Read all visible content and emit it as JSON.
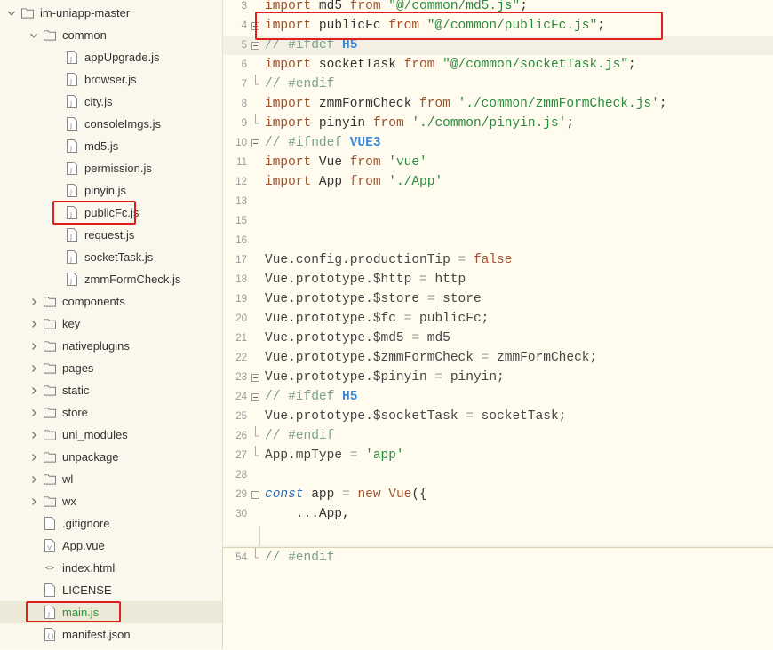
{
  "sidebar": {
    "items": [
      {
        "label": "im-uniapp-master",
        "type": "folder",
        "expanded": true,
        "indent": 0
      },
      {
        "label": "common",
        "type": "folder",
        "expanded": true,
        "indent": 1
      },
      {
        "label": "appUpgrade.js",
        "type": "js",
        "indent": 2
      },
      {
        "label": "browser.js",
        "type": "js",
        "indent": 2
      },
      {
        "label": "city.js",
        "type": "js",
        "indent": 2
      },
      {
        "label": "consoleImgs.js",
        "type": "js",
        "indent": 2
      },
      {
        "label": "md5.js",
        "type": "js",
        "indent": 2
      },
      {
        "label": "permission.js",
        "type": "js",
        "indent": 2
      },
      {
        "label": "pinyin.js",
        "type": "js",
        "indent": 2
      },
      {
        "label": "publicFc.js",
        "type": "js",
        "indent": 2
      },
      {
        "label": "request.js",
        "type": "js",
        "indent": 2
      },
      {
        "label": "socketTask.js",
        "type": "js",
        "indent": 2
      },
      {
        "label": "zmmFormCheck.js",
        "type": "js",
        "indent": 2
      },
      {
        "label": "components",
        "type": "folder",
        "expanded": false,
        "indent": 1
      },
      {
        "label": "key",
        "type": "folder",
        "expanded": false,
        "indent": 1
      },
      {
        "label": "nativeplugins",
        "type": "folder",
        "expanded": false,
        "indent": 1
      },
      {
        "label": "pages",
        "type": "folder",
        "expanded": false,
        "indent": 1
      },
      {
        "label": "static",
        "type": "folder",
        "expanded": false,
        "indent": 1
      },
      {
        "label": "store",
        "type": "folder",
        "expanded": false,
        "indent": 1
      },
      {
        "label": "uni_modules",
        "type": "folder",
        "expanded": false,
        "indent": 1
      },
      {
        "label": "unpackage",
        "type": "folder",
        "expanded": false,
        "indent": 1
      },
      {
        "label": "wl",
        "type": "folder",
        "expanded": false,
        "indent": 1
      },
      {
        "label": "wx",
        "type": "folder",
        "expanded": false,
        "indent": 1
      },
      {
        "label": ".gitignore",
        "type": "file",
        "indent": 1
      },
      {
        "label": "App.vue",
        "type": "vue",
        "indent": 1
      },
      {
        "label": "index.html",
        "type": "html",
        "indent": 1
      },
      {
        "label": "LICENSE",
        "type": "file",
        "indent": 1
      },
      {
        "label": "main.js",
        "type": "js",
        "indent": 1,
        "selected": true,
        "green": true
      },
      {
        "label": "manifest.json",
        "type": "json",
        "indent": 1
      }
    ]
  },
  "editor": {
    "lines": [
      {
        "n": "3",
        "fold": "",
        "tokens": [
          [
            "kw",
            "import"
          ],
          [
            "",
            " md5 "
          ],
          [
            "kw",
            "from"
          ],
          [
            "",
            " "
          ],
          [
            "str",
            "\"@/common/md5.js\""
          ],
          [
            "",
            ";"
          ]
        ]
      },
      {
        "n": "4",
        "fold": "box",
        "tokens": [
          [
            "kw",
            "import"
          ],
          [
            "",
            " publicFc "
          ],
          [
            "kw",
            "from"
          ],
          [
            "",
            " "
          ],
          [
            "str",
            "\"@/common/publicFc.js\""
          ],
          [
            "",
            ";"
          ]
        ]
      },
      {
        "n": "5",
        "fold": "box",
        "hl": true,
        "tokens": [
          [
            "cm",
            "// #ifdef "
          ],
          [
            "cmb",
            "H5"
          ]
        ]
      },
      {
        "n": "6",
        "fold": "",
        "tokens": [
          [
            "kw",
            "import"
          ],
          [
            "",
            " socketTask "
          ],
          [
            "kw",
            "from"
          ],
          [
            "",
            " "
          ],
          [
            "str",
            "\"@/common/socketTask.js\""
          ],
          [
            "",
            ";"
          ]
        ]
      },
      {
        "n": "7",
        "fold": "end",
        "tokens": [
          [
            "cm",
            "// #endif"
          ]
        ]
      },
      {
        "n": "8",
        "fold": "",
        "tokens": [
          [
            "kw",
            "import"
          ],
          [
            "",
            " zmmFormCheck "
          ],
          [
            "kw",
            "from"
          ],
          [
            "",
            " "
          ],
          [
            "str",
            "'./common/zmmFormCheck.js'"
          ],
          [
            "",
            ";"
          ]
        ]
      },
      {
        "n": "9",
        "fold": "end",
        "tokens": [
          [
            "kw",
            "import"
          ],
          [
            "",
            " pinyin "
          ],
          [
            "kw",
            "from"
          ],
          [
            "",
            " "
          ],
          [
            "str",
            "'./common/pinyin.js'"
          ],
          [
            "",
            ";"
          ]
        ]
      },
      {
        "n": "10",
        "fold": "box",
        "tokens": [
          [
            "cm",
            "// #ifndef "
          ],
          [
            "cmb",
            "VUE3"
          ]
        ]
      },
      {
        "n": "11",
        "fold": "",
        "tokens": [
          [
            "kw",
            "import"
          ],
          [
            "",
            " Vue "
          ],
          [
            "kw",
            "from"
          ],
          [
            "",
            " "
          ],
          [
            "str",
            "'vue'"
          ]
        ]
      },
      {
        "n": "12",
        "fold": "",
        "tokens": [
          [
            "kw",
            "import"
          ],
          [
            "",
            " App "
          ],
          [
            "kw",
            "from"
          ],
          [
            "",
            " "
          ],
          [
            "str",
            "'./App'"
          ]
        ]
      },
      {
        "n": "13",
        "fold": "",
        "tokens": []
      },
      {
        "n": "15",
        "fold": "",
        "tokens": []
      },
      {
        "n": "16",
        "fold": "",
        "tokens": []
      },
      {
        "n": "17",
        "fold": "",
        "tokens": [
          [
            "obj",
            "Vue.config.productionTip"
          ],
          [
            "op",
            " = "
          ],
          [
            "kw",
            "false"
          ]
        ]
      },
      {
        "n": "18",
        "fold": "",
        "tokens": [
          [
            "obj",
            "Vue.prototype.$http"
          ],
          [
            "op",
            " = "
          ],
          [
            "obj",
            "http"
          ]
        ]
      },
      {
        "n": "19",
        "fold": "",
        "tokens": [
          [
            "obj",
            "Vue.prototype.$store"
          ],
          [
            "op",
            " = "
          ],
          [
            "obj",
            "store"
          ]
        ]
      },
      {
        "n": "20",
        "fold": "",
        "tokens": [
          [
            "obj",
            "Vue.prototype.$fc"
          ],
          [
            "op",
            " = "
          ],
          [
            "obj",
            "publicFc;"
          ]
        ]
      },
      {
        "n": "21",
        "fold": "",
        "tokens": [
          [
            "obj",
            "Vue.prototype.$md5"
          ],
          [
            "op",
            " = "
          ],
          [
            "obj",
            "md5"
          ]
        ]
      },
      {
        "n": "22",
        "fold": "",
        "tokens": [
          [
            "obj",
            "Vue.prototype.$zmmFormCheck"
          ],
          [
            "op",
            " = "
          ],
          [
            "obj",
            "zmmFormCheck;"
          ]
        ]
      },
      {
        "n": "23",
        "fold": "box",
        "tokens": [
          [
            "obj",
            "Vue.prototype.$pinyin"
          ],
          [
            "op",
            " = "
          ],
          [
            "obj",
            "pinyin;"
          ]
        ]
      },
      {
        "n": "24",
        "fold": "box",
        "tokens": [
          [
            "cm",
            "// #ifdef "
          ],
          [
            "cmb",
            "H5"
          ]
        ]
      },
      {
        "n": "25",
        "fold": "",
        "tokens": [
          [
            "obj",
            "Vue.prototype.$socketTask"
          ],
          [
            "op",
            " = "
          ],
          [
            "obj",
            "socketTask;"
          ]
        ]
      },
      {
        "n": "26",
        "fold": "end",
        "tokens": [
          [
            "cm",
            "// #endif"
          ]
        ]
      },
      {
        "n": "27",
        "fold": "end",
        "tokens": [
          [
            "obj",
            "App.mpType"
          ],
          [
            "op",
            " = "
          ],
          [
            "str",
            "'app'"
          ]
        ]
      },
      {
        "n": "28",
        "fold": "",
        "tokens": []
      },
      {
        "n": "29",
        "fold": "box",
        "tokens": [
          [
            "kw2",
            "const"
          ],
          [
            "",
            " app "
          ],
          [
            "op",
            "="
          ],
          [
            "",
            " "
          ],
          [
            "kw",
            "new"
          ],
          [
            "",
            " "
          ],
          [
            "kw",
            "Vue"
          ],
          [
            "",
            "({"
          ]
        ]
      },
      {
        "n": "30",
        "fold": "",
        "tokens": [
          [
            "",
            "    ...App,"
          ]
        ]
      }
    ],
    "popup_line": {
      "n": "54",
      "tokens": [
        [
          "cm",
          "// #endif"
        ]
      ]
    }
  },
  "colors": {
    "highlight_box": "#e02020",
    "accent_green": "#2c9a3a"
  }
}
